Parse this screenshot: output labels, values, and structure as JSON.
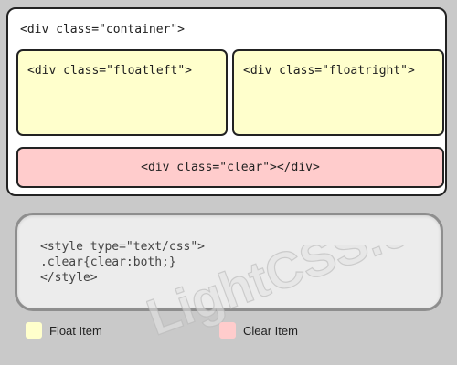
{
  "diagram": {
    "container_label": "<div class=\"container\">",
    "float_left_label": "<div class=\"floatleft\">",
    "float_right_label": "<div class=\"floatright\">",
    "clear_label": "<div class=\"clear\"></div>"
  },
  "style_block": {
    "line1": "<style type=\"text/css\">",
    "line2": ".clear{clear:both;}",
    "line3": "</style>"
  },
  "watermark": {
    "text": "LightCSS.com"
  },
  "legend": {
    "float_item": "Float Item",
    "clear_item": "Clear Item"
  },
  "colors": {
    "float": "#ffffcc",
    "clear": "#ffcccc",
    "background": "#c9c9c9"
  }
}
